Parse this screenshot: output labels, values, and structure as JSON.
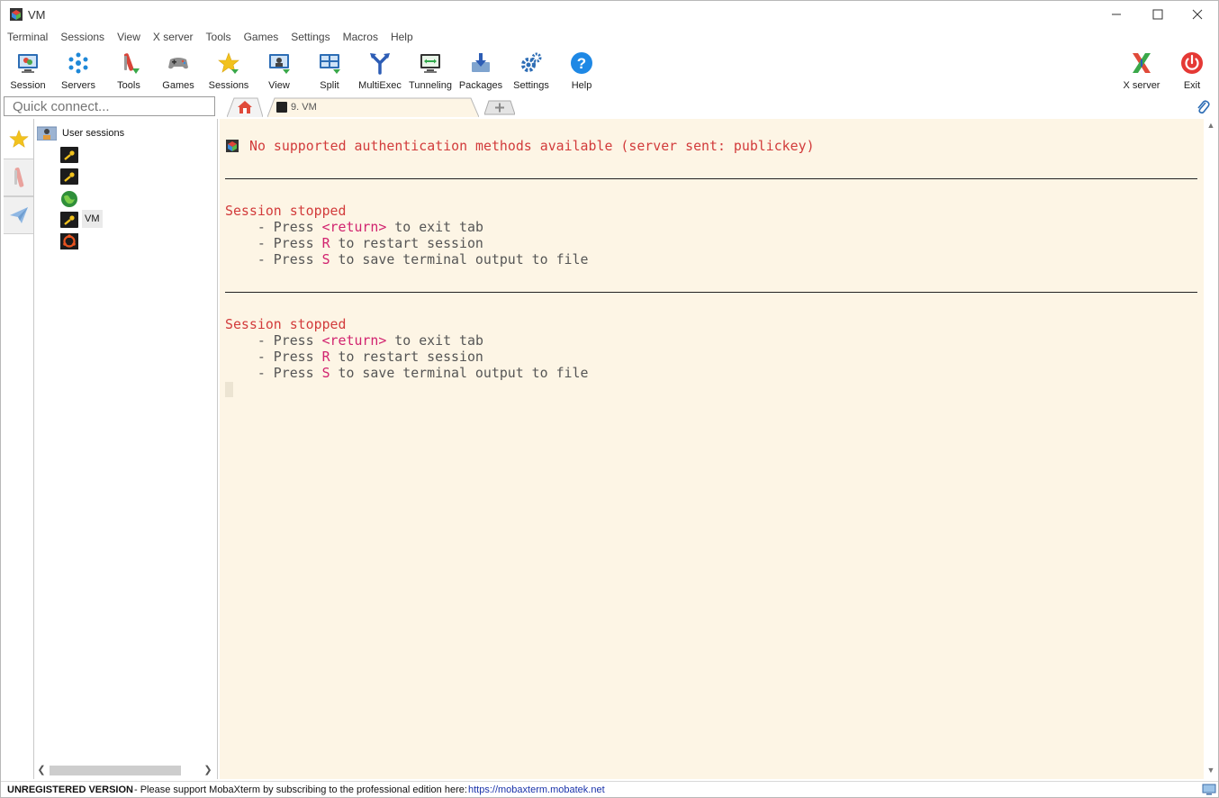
{
  "window": {
    "title": "VM"
  },
  "menu": [
    "Terminal",
    "Sessions",
    "View",
    "X server",
    "Tools",
    "Games",
    "Settings",
    "Macros",
    "Help"
  ],
  "toolbar": {
    "session": "Session",
    "servers": "Servers",
    "tools": "Tools",
    "games": "Games",
    "sessions": "Sessions",
    "view": "View",
    "split": "Split",
    "multiexec": "MultiExec",
    "tunneling": "Tunneling",
    "packages": "Packages",
    "settings": "Settings",
    "help": "Help",
    "xserver": "X server",
    "exit": "Exit"
  },
  "quick_connect": {
    "placeholder": "Quick connect..."
  },
  "tabs": {
    "active_label": "9. VM"
  },
  "sidebar": {
    "root_label": "User sessions",
    "items": [
      {
        "icon": "key-icon",
        "label": ""
      },
      {
        "icon": "key-icon",
        "label": ""
      },
      {
        "icon": "globe-icon",
        "label": ""
      },
      {
        "icon": "key-icon",
        "label": "VM"
      },
      {
        "icon": "ubuntu-icon",
        "label": ""
      }
    ]
  },
  "terminal": {
    "error": "No supported authentication methods available (server sent: publickey)",
    "stopped1": "Session stopped",
    "stopped2": "Session stopped",
    "press_prefix": "    - Press ",
    "return_key": "<return>",
    "return_suffix": " to exit tab",
    "r_key": "R",
    "r_suffix": " to restart session",
    "s_key": "S",
    "s_suffix": " to save terminal output to file"
  },
  "status": {
    "unregistered": "UNREGISTERED VERSION",
    "message": "-  Please support MobaXterm by subscribing to the professional edition here:",
    "link": "https://mobaxterm.mobatek.net"
  },
  "colors": {
    "terminal_bg": "#fdf5e5",
    "error_red": "#d23b3b",
    "key_pink": "#d1236f"
  }
}
